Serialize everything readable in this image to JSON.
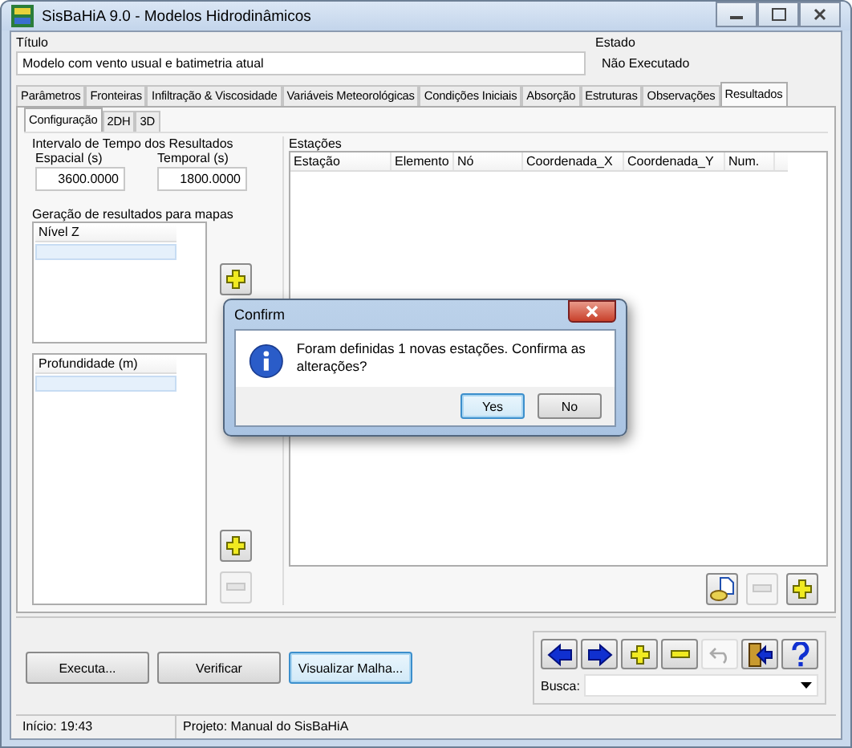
{
  "window": {
    "title": "SisBaHiA 9.0 - Modelos Hidrodinâmicos"
  },
  "header": {
    "title_label": "Título",
    "title_value": "Modelo com vento usual e batimetria atual",
    "state_label": "Estado",
    "state_value": "Não Executado"
  },
  "tabs": [
    {
      "label": "Parâmetros",
      "selected": false
    },
    {
      "label": "Fronteiras",
      "selected": false
    },
    {
      "label": "Infiltração & Viscosidade",
      "selected": false
    },
    {
      "label": "Variáveis Meteorológicas",
      "selected": false
    },
    {
      "label": "Condições Iniciais",
      "selected": false
    },
    {
      "label": "Absorção",
      "selected": false
    },
    {
      "label": "Estruturas",
      "selected": false
    },
    {
      "label": "Observações",
      "selected": false
    },
    {
      "label": "Resultados",
      "selected": true
    }
  ],
  "subtabs": [
    {
      "label": "Configuração",
      "selected": true
    },
    {
      "label": "2DH",
      "selected": false
    },
    {
      "label": "3D",
      "selected": false
    }
  ],
  "interval": {
    "title": "Intervalo de Tempo dos Resultados",
    "fields": [
      {
        "label": "Espacial (s)",
        "value": "3600.0000"
      },
      {
        "label": "Temporal (s)",
        "value": "1800.0000"
      }
    ]
  },
  "maps": {
    "title": "Geração de resultados para mapas",
    "lists": [
      {
        "header": "Nível Z"
      },
      {
        "header": "Profundidade (m)"
      }
    ]
  },
  "stations": {
    "title": "Estações",
    "columns": [
      "Estação",
      "Elemento",
      "Nó",
      "Coordenada_X",
      "Coordenada_Y",
      "Num."
    ]
  },
  "buttons": [
    {
      "label": "Executa...",
      "focused": false
    },
    {
      "label": "Verificar",
      "focused": false
    },
    {
      "label": "Visualizar Malha...",
      "focused": true
    }
  ],
  "search": {
    "label": "Busca:"
  },
  "status_bar": [
    "Início: 19:43",
    "Projeto: Manual do SisBaHiA"
  ],
  "dialog": {
    "title": "Confirm",
    "message": "Foram definidas 1 novas estações. Confirma as alterações?",
    "buttons": [
      {
        "label": "Yes",
        "focused": true
      },
      {
        "label": "No",
        "focused": false
      }
    ]
  }
}
